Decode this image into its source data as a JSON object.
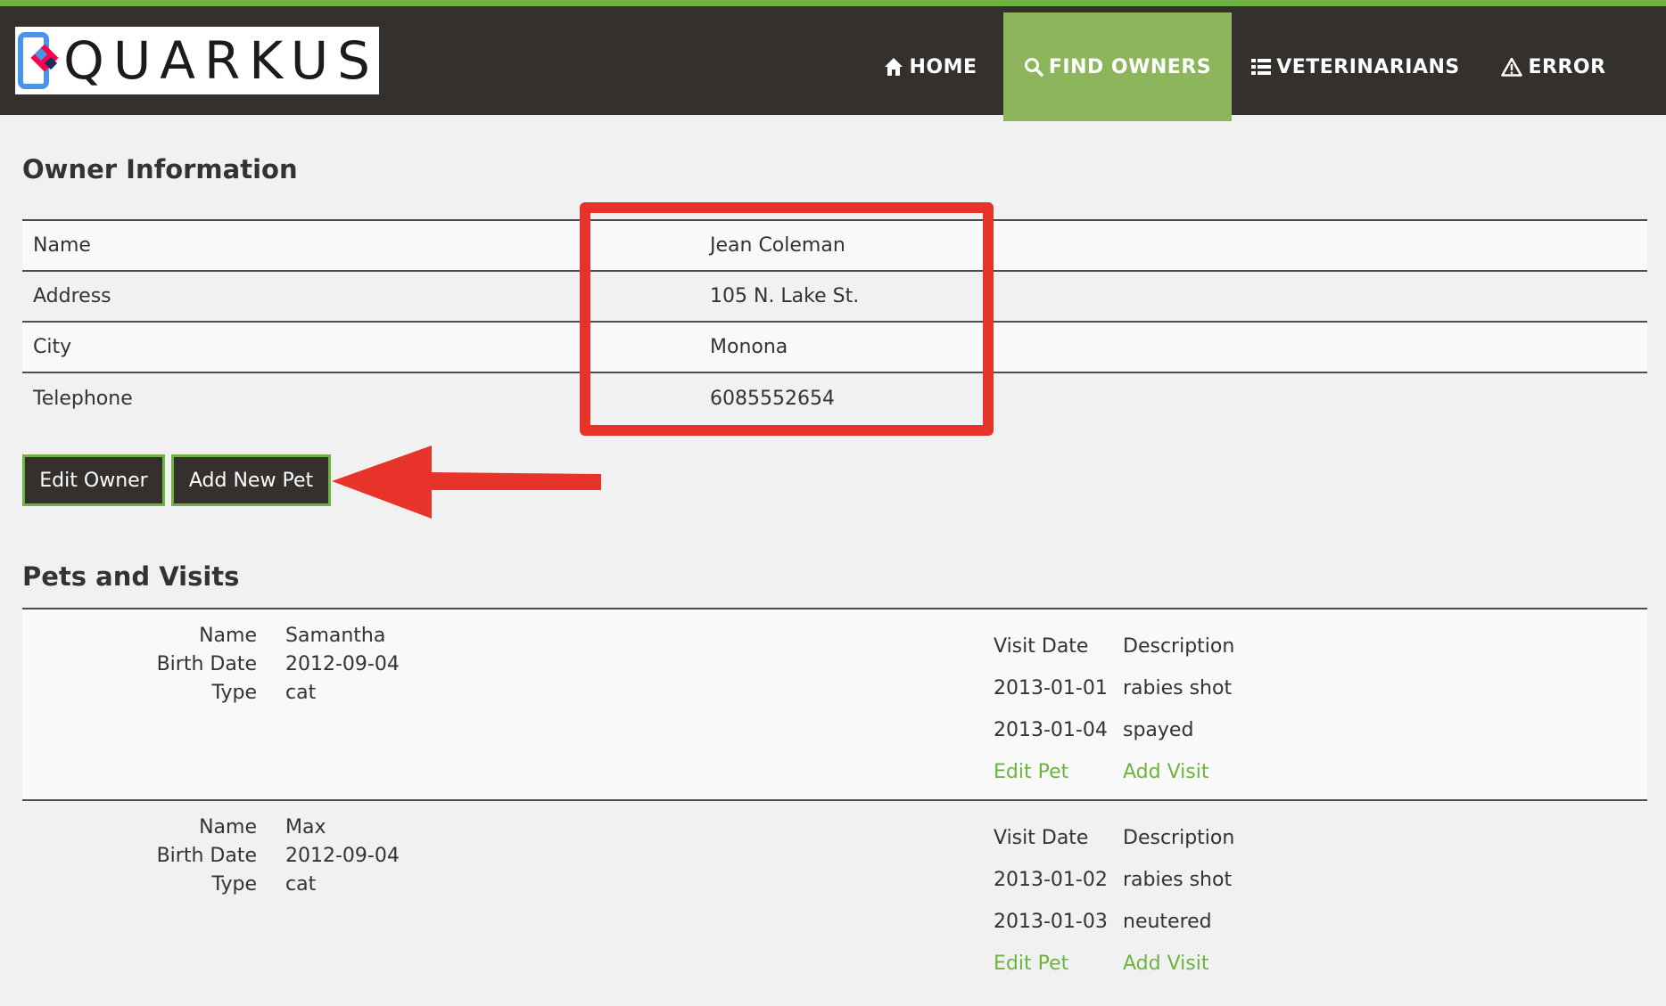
{
  "brand": {
    "logo_text": "QUARKUS"
  },
  "nav": {
    "items": [
      {
        "label": "HOME",
        "icon": "home-icon"
      },
      {
        "label": "FIND OWNERS",
        "icon": "search-icon",
        "active": true
      },
      {
        "label": "VETERINARIANS",
        "icon": "list-icon"
      },
      {
        "label": "ERROR",
        "icon": "warning-icon"
      }
    ]
  },
  "owner": {
    "section_title": "Owner Information",
    "rows": [
      {
        "label": "Name",
        "value": "Jean Coleman"
      },
      {
        "label": "Address",
        "value": "105 N. Lake St."
      },
      {
        "label": "City",
        "value": "Monona"
      },
      {
        "label": "Telephone",
        "value": "6085552654"
      }
    ],
    "edit_button": "Edit Owner",
    "add_pet_button": "Add New Pet"
  },
  "pets": {
    "section_title": "Pets and Visits",
    "labels": {
      "name": "Name",
      "birth_date": "Birth Date",
      "type": "Type"
    },
    "visit_headers": {
      "date": "Visit Date",
      "description": "Description"
    },
    "actions": {
      "edit_pet": "Edit Pet",
      "add_visit": "Add Visit"
    },
    "items": [
      {
        "name": "Samantha",
        "birth_date": "2012-09-04",
        "type": "cat",
        "visits": [
          {
            "date": "2013-01-01",
            "description": "rabies shot"
          },
          {
            "date": "2013-01-04",
            "description": "spayed"
          }
        ]
      },
      {
        "name": "Max",
        "birth_date": "2012-09-04",
        "type": "cat",
        "visits": [
          {
            "date": "2013-01-02",
            "description": "rabies shot"
          },
          {
            "date": "2013-01-03",
            "description": "neutered"
          }
        ]
      }
    ]
  },
  "colors": {
    "brand_green": "#6db33f",
    "nav_active": "#8db65c",
    "nav_bg": "#34302d",
    "annotation_red": "#e8332a"
  }
}
